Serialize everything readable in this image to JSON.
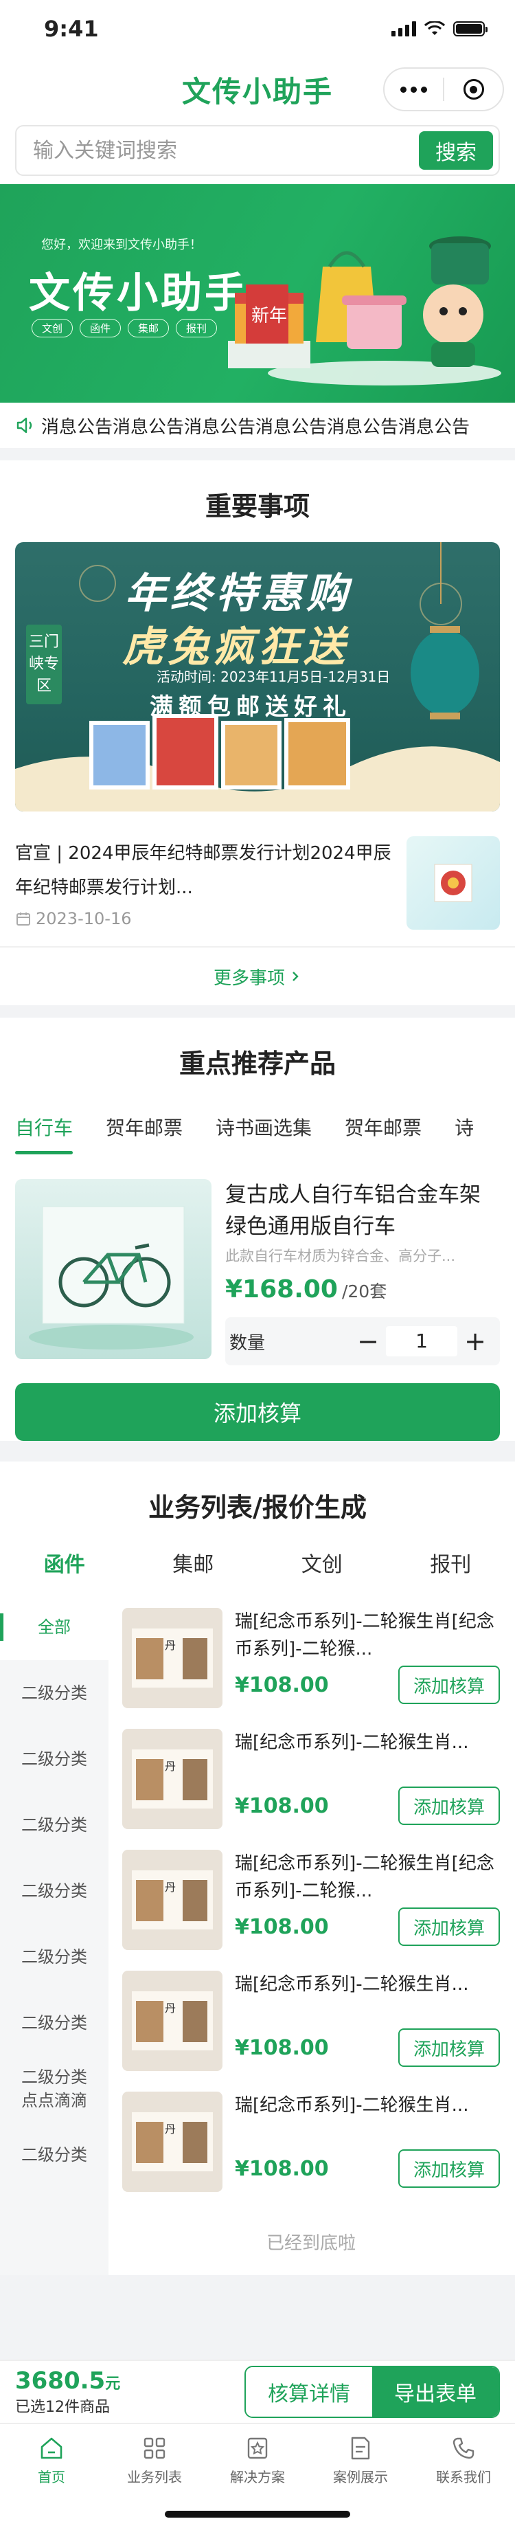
{
  "status_bar": {
    "time": "9:41"
  },
  "nav": {
    "title": "文传小助手"
  },
  "search": {
    "placeholder": "输入关键词搜索",
    "button": "搜索"
  },
  "banner": {
    "greeting": "您好，欢迎来到文传小助手！",
    "title": "文传小助手",
    "tags": [
      "文创",
      "函件",
      "集邮",
      "报刊"
    ],
    "art_text": "新年"
  },
  "notice": {
    "text": "消息公告消息公告消息公告消息公告消息公告消息公告"
  },
  "important": {
    "title": "重要事项",
    "promo": {
      "line1": "年终特惠购",
      "line2": "虎兔疯狂送",
      "date": "活动时间: 2023年11月5日-12月31日",
      "line3": "满额包邮送好礼",
      "side": "三门峡专区"
    },
    "news": {
      "title": "官宣 | 2024甲辰年纪特邮票发行计划2024甲辰年纪特邮票发行计划...",
      "date": "2023-10-16"
    },
    "more": "更多事项"
  },
  "recommend": {
    "title": "重点推荐产品",
    "tabs": [
      "自行车",
      "贺年邮票",
      "诗书画选集",
      "贺年邮票",
      "诗"
    ],
    "product": {
      "name": "复古成人自行车铝合金车架绿色通用版自行车",
      "desc": "此款自行车材质为锌合金、高分子...",
      "price": "¥168.00",
      "unit": "/20套",
      "qty_label": "数量",
      "qty": "1",
      "minus": "−",
      "plus": "+"
    },
    "add_button": "添加核算"
  },
  "business": {
    "title": "业务列表/报价生成",
    "tabs": [
      "函件",
      "集邮",
      "文创",
      "报刊"
    ],
    "categories": [
      "全部",
      "二级分类",
      "二级分类",
      "二级分类",
      "二级分类",
      "二级分类",
      "二级分类",
      "二级分类点点滴滴",
      "二级分类"
    ],
    "items": [
      {
        "title": "瑞[纪念币系列]-二轮猴生肖[纪念币系列]-二轮猴...",
        "price": "¥108.00",
        "button": "添加核算"
      },
      {
        "title": "瑞[纪念币系列]-二轮猴生肖...",
        "price": "¥108.00",
        "button": "添加核算"
      },
      {
        "title": "瑞[纪念币系列]-二轮猴生肖[纪念币系列]-二轮猴...",
        "price": "¥108.00",
        "button": "添加核算"
      },
      {
        "title": "瑞[纪念币系列]-二轮猴生肖...",
        "price": "¥108.00",
        "button": "添加核算"
      },
      {
        "title": "瑞[纪念币系列]-二轮猴生肖...",
        "price": "¥108.00",
        "button": "添加核算"
      }
    ],
    "end_text": "已经到底啦"
  },
  "cart": {
    "total": "3680.5",
    "currency": "元",
    "count": "已选12件商品",
    "detail_button": "核算详情",
    "export_button": "导出表单"
  },
  "tabbar": {
    "items": [
      "首页",
      "业务列表",
      "解决方案",
      "案例展示",
      "联系我们"
    ],
    "active": 0
  },
  "colors": {
    "brand": "#1fa35a",
    "price": "#1fa35a"
  }
}
